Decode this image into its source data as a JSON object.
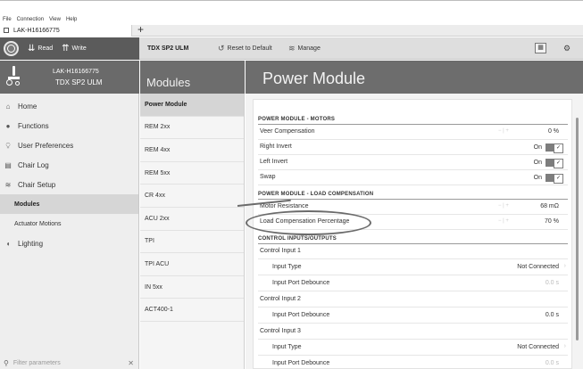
{
  "menubar": {
    "items": [
      "File",
      "Connection",
      "View",
      "Help"
    ]
  },
  "tabs": {
    "active_label": "LAK-H16166775",
    "add_label": "+"
  },
  "toolbar": {
    "read_label": "Read",
    "write_label": "Write",
    "device_label": "TDX SP2 ULM",
    "reset_label": "Reset to Default",
    "manage_label": "Manage"
  },
  "device_card": {
    "line1": "LAK-H16166775",
    "line2": "TDX SP2 ULM"
  },
  "sidebar": {
    "items": [
      {
        "label": "Home",
        "icon": "home-icon",
        "glyph": "⌂"
      },
      {
        "label": "Functions",
        "icon": "functions-icon",
        "glyph": "●"
      },
      {
        "label": "User Preferences",
        "icon": "user-icon",
        "glyph": "⍜"
      },
      {
        "label": "Chair Log",
        "icon": "log-icon",
        "glyph": "▤"
      },
      {
        "label": "Chair Setup",
        "icon": "setup-icon",
        "glyph": "≋"
      },
      {
        "label": "Modules",
        "sub": true,
        "active": true
      },
      {
        "label": "Actuator Motions",
        "sub": true
      },
      {
        "label": "Lighting",
        "icon": "lighting-icon",
        "glyph": "◖"
      }
    ],
    "filter_placeholder": "Filter parameters",
    "filter_clear": "✕"
  },
  "modules": {
    "title": "Modules",
    "items": [
      "Power Module",
      "REM 2xx",
      "REM 4xx",
      "REM 5xx",
      "CR 4xx",
      "ACU 2xx",
      "TPI",
      "TPI ACU",
      "IN 5xx",
      "ACT400-1"
    ],
    "active_index": 0
  },
  "main": {
    "title": "Power Module",
    "sections": {
      "motors_title": "POWER MODULE - MOTORS",
      "load_title": "POWER MODULE - LOAD COMPENSATION",
      "io_title": "CONTROL INPUTS/OUTPUTS"
    },
    "rows": {
      "veer": {
        "label": "Veer Compensation",
        "value": "0 %"
      },
      "right_invert": {
        "label": "Right Invert",
        "value": "On"
      },
      "left_invert": {
        "label": "Left Invert",
        "value": "On"
      },
      "swap": {
        "label": "Swap",
        "value": "On"
      },
      "motor_resistance": {
        "label": "Motor Resistance",
        "value": "68 mΩ"
      },
      "load_comp": {
        "label": "Load Compensation Percentage",
        "value": "70 %"
      },
      "ci1": {
        "label": "Control Input 1"
      },
      "ci1_type": {
        "label": "Input Type",
        "value": "Not Connected"
      },
      "ci1_debounce": {
        "label": "Input Port Debounce",
        "value": "0.0 s"
      },
      "ci2": {
        "label": "Control Input 2"
      },
      "ci2_debounce": {
        "label": "Input Port Debounce",
        "value": "0.0 s"
      },
      "ci3": {
        "label": "Control Input 3"
      },
      "ci3_type": {
        "label": "Input Type",
        "value": "Not Connected"
      },
      "ci3_debounce": {
        "label": "Input Port Debounce",
        "value": "0.0 s"
      }
    },
    "stepper_minus": "−",
    "stepper_plus": "+"
  }
}
